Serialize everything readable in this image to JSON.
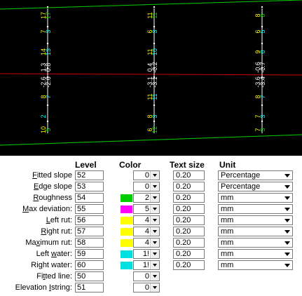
{
  "canvas": {
    "colors": {
      "green": "#00d000",
      "red": "#d00000",
      "white": "#ffffff",
      "yellow": "#ffff00",
      "cyan": "#00ffff"
    },
    "stations": [
      {
        "top_green": "17",
        "top_pair": [
          "7",
          "3"
        ],
        "mid1": [
          "14",
          "13"
        ],
        "mid2": [
          "1.3",
          "0.8"
        ],
        "low1": [
          "-2.6",
          "-2.6"
        ],
        "low2": [
          "8",
          "7"
        ],
        "low3": [
          "2"
        ],
        "bot": [
          "10",
          "5"
        ]
      },
      {
        "top_green": "11",
        "top_pair": [
          "6",
          "3"
        ],
        "mid1": [
          "11",
          "10"
        ],
        "mid2": [
          "0.4",
          "-0.2"
        ],
        "low1": [
          "-3.1",
          "-3.1"
        ],
        "low2": [
          "11",
          "11"
        ],
        "low3": [
          "8",
          "3"
        ],
        "bot": [
          "6",
          "12"
        ]
      },
      {
        "top_green": "8",
        "top_pair": [
          "6",
          "5"
        ],
        "mid1": [
          "9",
          "8"
        ],
        "mid2": [
          "-0.6",
          "-0.7"
        ],
        "low1": [
          "-3.6",
          "-3.4"
        ],
        "low2": [
          "8",
          "7"
        ],
        "low3": [
          "7",
          "3"
        ],
        "bot": [
          "7",
          "3"
        ]
      }
    ]
  },
  "panel": {
    "headers": {
      "level": "Level",
      "color": "Color",
      "text_size": "Text size",
      "unit": "Unit"
    },
    "rows": [
      {
        "label_pre": "",
        "label_u": "F",
        "label_post": "itted slope",
        "level": "52",
        "swatch": "",
        "color_val": "0",
        "text_size": "0.20",
        "unit": "Percentage"
      },
      {
        "label_pre": "",
        "label_u": "E",
        "label_post": "dge slope",
        "level": "53",
        "swatch": "",
        "color_val": "0",
        "text_size": "0.20",
        "unit": "Percentage"
      },
      {
        "label_pre": "",
        "label_u": "R",
        "label_post": "oughness",
        "level": "54",
        "swatch": "#00cc00",
        "color_val": "2",
        "text_size": "0.20",
        "unit": "mm"
      },
      {
        "label_pre": "",
        "label_u": "M",
        "label_post": "ax deviation:",
        "level": "55",
        "swatch": "#ff00ff",
        "color_val": "5",
        "text_size": "0.20",
        "unit": "mm"
      },
      {
        "label_pre": "",
        "label_u": "L",
        "label_post": "eft rut:",
        "level": "56",
        "swatch": "#ffff00",
        "color_val": "4",
        "text_size": "0.20",
        "unit": "mm"
      },
      {
        "label_pre": "",
        "label_u": "R",
        "label_post": "ight rut:",
        "level": "57",
        "swatch": "#ffff00",
        "color_val": "4",
        "text_size": "0.20",
        "unit": "mm"
      },
      {
        "label_pre": "Ma",
        "label_u": "x",
        "label_post": "imum rut:",
        "level": "58",
        "swatch": "#ffff00",
        "color_val": "4",
        "text_size": "0.20",
        "unit": "mm"
      },
      {
        "label_pre": "Left ",
        "label_u": "w",
        "label_post": "ater:",
        "level": "59",
        "swatch": "#00e0e0",
        "color_val": "1!",
        "text_size": "0.20",
        "unit": "mm"
      },
      {
        "label_pre": "Ri",
        "label_u": "g",
        "label_post": "ht water:",
        "level": "60",
        "swatch": "#00e0e0",
        "color_val": "1!",
        "text_size": "0.20",
        "unit": "mm"
      },
      {
        "label_pre": "Fi",
        "label_u": "t",
        "label_post": "ted line:",
        "level": "50",
        "swatch": "",
        "color_val": "0",
        "text_size": "",
        "unit": ""
      },
      {
        "label_pre": "Elevation ",
        "label_u": "I",
        "label_post": "string:",
        "level": "51",
        "swatch": "",
        "color_val": "0",
        "text_size": "",
        "unit": ""
      }
    ]
  }
}
